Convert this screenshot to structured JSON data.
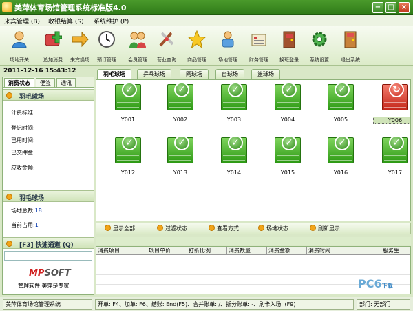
{
  "window": {
    "title": "美萍体育场馆管理系统标准版4.0",
    "controls": {
      "minimize": "−",
      "maximize": "□",
      "close": "×"
    }
  },
  "menu": [
    {
      "label": "来宾管理 (B)"
    },
    {
      "label": "收银结算 (S)"
    },
    {
      "label": "系统维护 (P)"
    }
  ],
  "toolbar": [
    {
      "label": "场地开关",
      "icon": "person-icon"
    },
    {
      "label": "追加消费",
      "icon": "add-consume-icon"
    },
    {
      "label": "来宾换场",
      "icon": "swap-arrow-icon"
    },
    {
      "label": "预订管理",
      "icon": "clock-icon"
    },
    {
      "label": "会员管理",
      "icon": "members-icon"
    },
    {
      "label": "营业查询",
      "icon": "search-tools-icon"
    },
    {
      "label": "商品管理",
      "icon": "star-icon"
    },
    {
      "label": "场地管理",
      "icon": "court-staff-icon"
    },
    {
      "label": "财务管理",
      "icon": "finance-icon"
    },
    {
      "label": "换班登录",
      "icon": "shift-door-icon"
    },
    {
      "label": "系统设置",
      "icon": "settings-gear-icon"
    },
    {
      "label": "退出系统",
      "icon": "exit-door-icon"
    }
  ],
  "datetime": "2011-12-16 15:43:12",
  "left_tabs": [
    {
      "label": "消费状态",
      "active": true
    },
    {
      "label": "便签",
      "active": false
    },
    {
      "label": "通讯",
      "active": false
    }
  ],
  "consume_section": {
    "title": "羽毛球场",
    "fields": [
      {
        "label": "计费标准:",
        "value": ""
      },
      {
        "label": "登记时间:",
        "value": ""
      },
      {
        "label": "已用时间:",
        "value": ""
      },
      {
        "label": "已交押金:",
        "value": ""
      },
      {
        "label": "应收金额:",
        "value": ""
      }
    ]
  },
  "summary_section": {
    "title": "羽毛球场",
    "fields": [
      {
        "label": "场地总数:",
        "value": "18"
      },
      {
        "label": "当前占用:",
        "value": "1"
      }
    ]
  },
  "quick_channel": {
    "title": "[F3] 快速通道 (Q)",
    "value": ""
  },
  "branding": {
    "logo_mp": "MP",
    "logo_soft": "SOFT",
    "slogan": "管理软件 美萍是专家"
  },
  "court_tabs": [
    {
      "label": "羽毛球场",
      "active": true
    },
    {
      "label": "乒乓球场",
      "active": false
    },
    {
      "label": "网球场",
      "active": false
    },
    {
      "label": "台球场",
      "active": false
    },
    {
      "label": "篮球场",
      "active": false
    }
  ],
  "courts": [
    {
      "label": "Y001",
      "status": "free",
      "selected": false
    },
    {
      "label": "Y002",
      "status": "free",
      "selected": false
    },
    {
      "label": "Y003",
      "status": "free",
      "selected": false
    },
    {
      "label": "Y004",
      "status": "free",
      "selected": false
    },
    {
      "label": "Y005",
      "status": "free",
      "selected": false
    },
    {
      "label": "Y006",
      "status": "busy",
      "selected": true
    },
    {
      "label": "Y012",
      "status": "free",
      "selected": false
    },
    {
      "label": "Y013",
      "status": "free",
      "selected": false
    },
    {
      "label": "Y014",
      "status": "free",
      "selected": false
    },
    {
      "label": "Y015",
      "status": "free",
      "selected": false
    },
    {
      "label": "Y016",
      "status": "free",
      "selected": false
    },
    {
      "label": "Y017",
      "status": "free",
      "selected": false
    }
  ],
  "court_actions": [
    {
      "label": "显示全部"
    },
    {
      "label": "过滤状态"
    },
    {
      "label": "查看方式"
    },
    {
      "label": "场地状态"
    },
    {
      "label": "刷新显示"
    }
  ],
  "grid_columns": [
    "消费项目",
    "项目单价",
    "打折比例",
    "消费数量",
    "消费金额",
    "消费时间",
    "服务生"
  ],
  "watermark": {
    "main": "PC6",
    "sub": "下载"
  },
  "status": {
    "system": "美萍体育场馆管理系统",
    "shortcuts": "开单: F4、加单: F6、结账: End(F5)、合并账单: /、拆分账单: -、刷卡入场: (F9)",
    "dept": "部门: 无部门"
  },
  "colors": {
    "free": "#2d9a14",
    "busy": "#c4261a",
    "accent": "#3c8a26"
  }
}
